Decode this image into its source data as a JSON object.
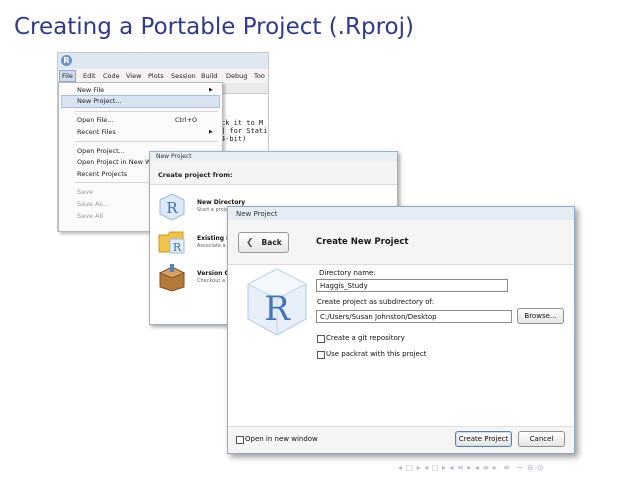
{
  "slide": {
    "title": "Creating a Portable Project (.Rproj)"
  },
  "rstudio": {
    "menubar": [
      "File",
      "Edit",
      "Code",
      "View",
      "Plots",
      "Session",
      "Build",
      "Debug",
      "Too"
    ],
    "editor_lines": [
      "ck it to M",
      "] for Stati",
      "4-bit)"
    ],
    "file_menu": {
      "new_file": "New File",
      "new_project": "New Project...",
      "open_file": "Open File...",
      "open_file_shortcut": "Ctrl+O",
      "recent_files": "Recent Files",
      "open_project": "Open Project...",
      "open_project_new_window": "Open Project in New Win",
      "recent_projects": "Recent Projects",
      "save": "Save",
      "save_as": "Save As...",
      "save_all": "Save All"
    }
  },
  "dialog_back": {
    "title": "New Project",
    "heading": "Create project from:",
    "options": [
      {
        "label": "New Directory",
        "sub": "Start a proje"
      },
      {
        "label": "Existing D",
        "sub": "Associate a"
      },
      {
        "label": "Version C",
        "sub": "Checkout a"
      }
    ]
  },
  "dialog_front": {
    "title": "New Project",
    "back_label": "Back",
    "heading": "Create New Project",
    "dir_name_label": "Directory name:",
    "dir_name_value": "Haggis_Study",
    "subdir_label": "Create project as subdirectory of:",
    "subdir_value": "C:/Users/Susan Johnston/Desktop",
    "browse_label": "Browse...",
    "git_label": "Create a git repository",
    "packrat_label": "Use packrat with this project",
    "open_new_window_label": "Open in new window",
    "create_label": "Create Project",
    "cancel_label": "Cancel",
    "git_checked": false,
    "packrat_checked": false,
    "open_new_window_checked": false
  },
  "colors": {
    "title": "#303a88",
    "accent": "#5b7fb1",
    "r_logo": "#3d6db3"
  }
}
